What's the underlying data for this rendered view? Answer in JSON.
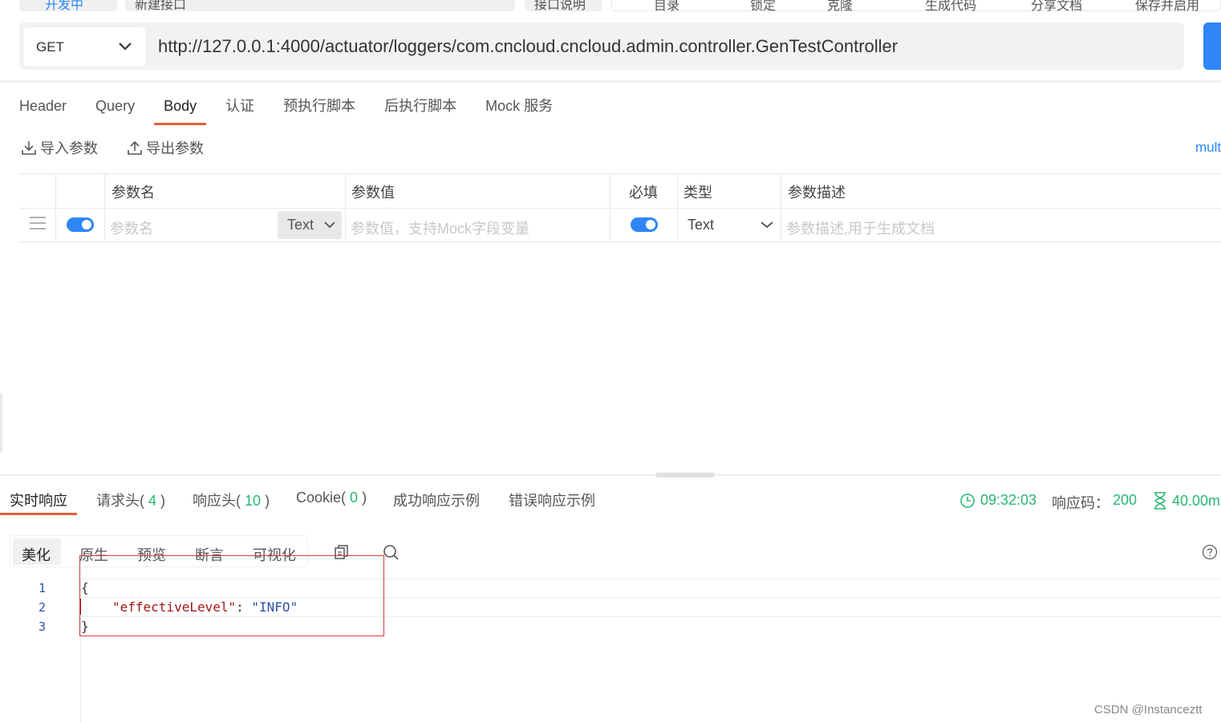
{
  "top_bar": {
    "items": [
      "开发中",
      "新建接口",
      "接口说明",
      "|",
      "目录",
      "锁定",
      "克隆",
      "生成代码",
      "分享文档",
      "保存并启用"
    ]
  },
  "request": {
    "method": "GET",
    "url": "http://127.0.0.1:4000/actuator/loggers/com.cncloud.cncloud.admin.controller.GenTestController"
  },
  "request_tabs": [
    {
      "label": "Header",
      "active": false
    },
    {
      "label": "Query",
      "active": false
    },
    {
      "label": "Body",
      "active": true
    },
    {
      "label": "认证",
      "active": false
    },
    {
      "label": "预执行脚本",
      "active": false
    },
    {
      "label": "后执行脚本",
      "active": false
    },
    {
      "label": "Mock 服务",
      "active": false
    }
  ],
  "body_toolbar": {
    "import_label": "导入参数",
    "export_label": "导出参数",
    "mode_link": "mult"
  },
  "params_table": {
    "headers": {
      "name": "参数名",
      "value": "参数值",
      "required": "必填",
      "type": "类型",
      "description": "参数描述"
    },
    "row": {
      "enabled": true,
      "name_placeholder": "参数名",
      "name_type": "Text",
      "value_placeholder": "参数值，支持Mock字段变量",
      "required": true,
      "type": "Text",
      "description_placeholder": "参数描述,用于生成文档"
    }
  },
  "response_tabs": [
    {
      "label": "实时响应",
      "count": "",
      "active": true
    },
    {
      "label": "请求头(",
      "count": "4",
      "suffix": ")",
      "active": false
    },
    {
      "label": "响应头(",
      "count": "10",
      "suffix": ")",
      "active": false
    },
    {
      "label": "Cookie(",
      "count": "0",
      "suffix": ")",
      "active": false
    },
    {
      "label": "成功响应示例",
      "count": "",
      "active": false
    },
    {
      "label": "错误响应示例",
      "count": "",
      "active": false
    }
  ],
  "response_status": {
    "time": "09:32:03",
    "code_label": "响应码：",
    "code": "200",
    "duration": "40.00m"
  },
  "view_modes": [
    {
      "label": "美化",
      "active": true
    },
    {
      "label": "原生",
      "active": false
    },
    {
      "label": "预览",
      "active": false
    },
    {
      "label": "断言",
      "active": false
    },
    {
      "label": "可视化",
      "active": false
    }
  ],
  "response_body": {
    "line_numbers": [
      "1",
      "2",
      "3"
    ],
    "open_brace": "{",
    "key": "\"effectiveLevel\"",
    "colon": ": ",
    "value": "\"INFO\"",
    "close_brace": "}"
  },
  "watermark": "CSDN @Instanceztt",
  "colors": {
    "accent_blue": "#2f86f6",
    "tab_underline": "#e0623e",
    "success_green": "#2bb673",
    "highlight_red": "#d43c3c"
  }
}
